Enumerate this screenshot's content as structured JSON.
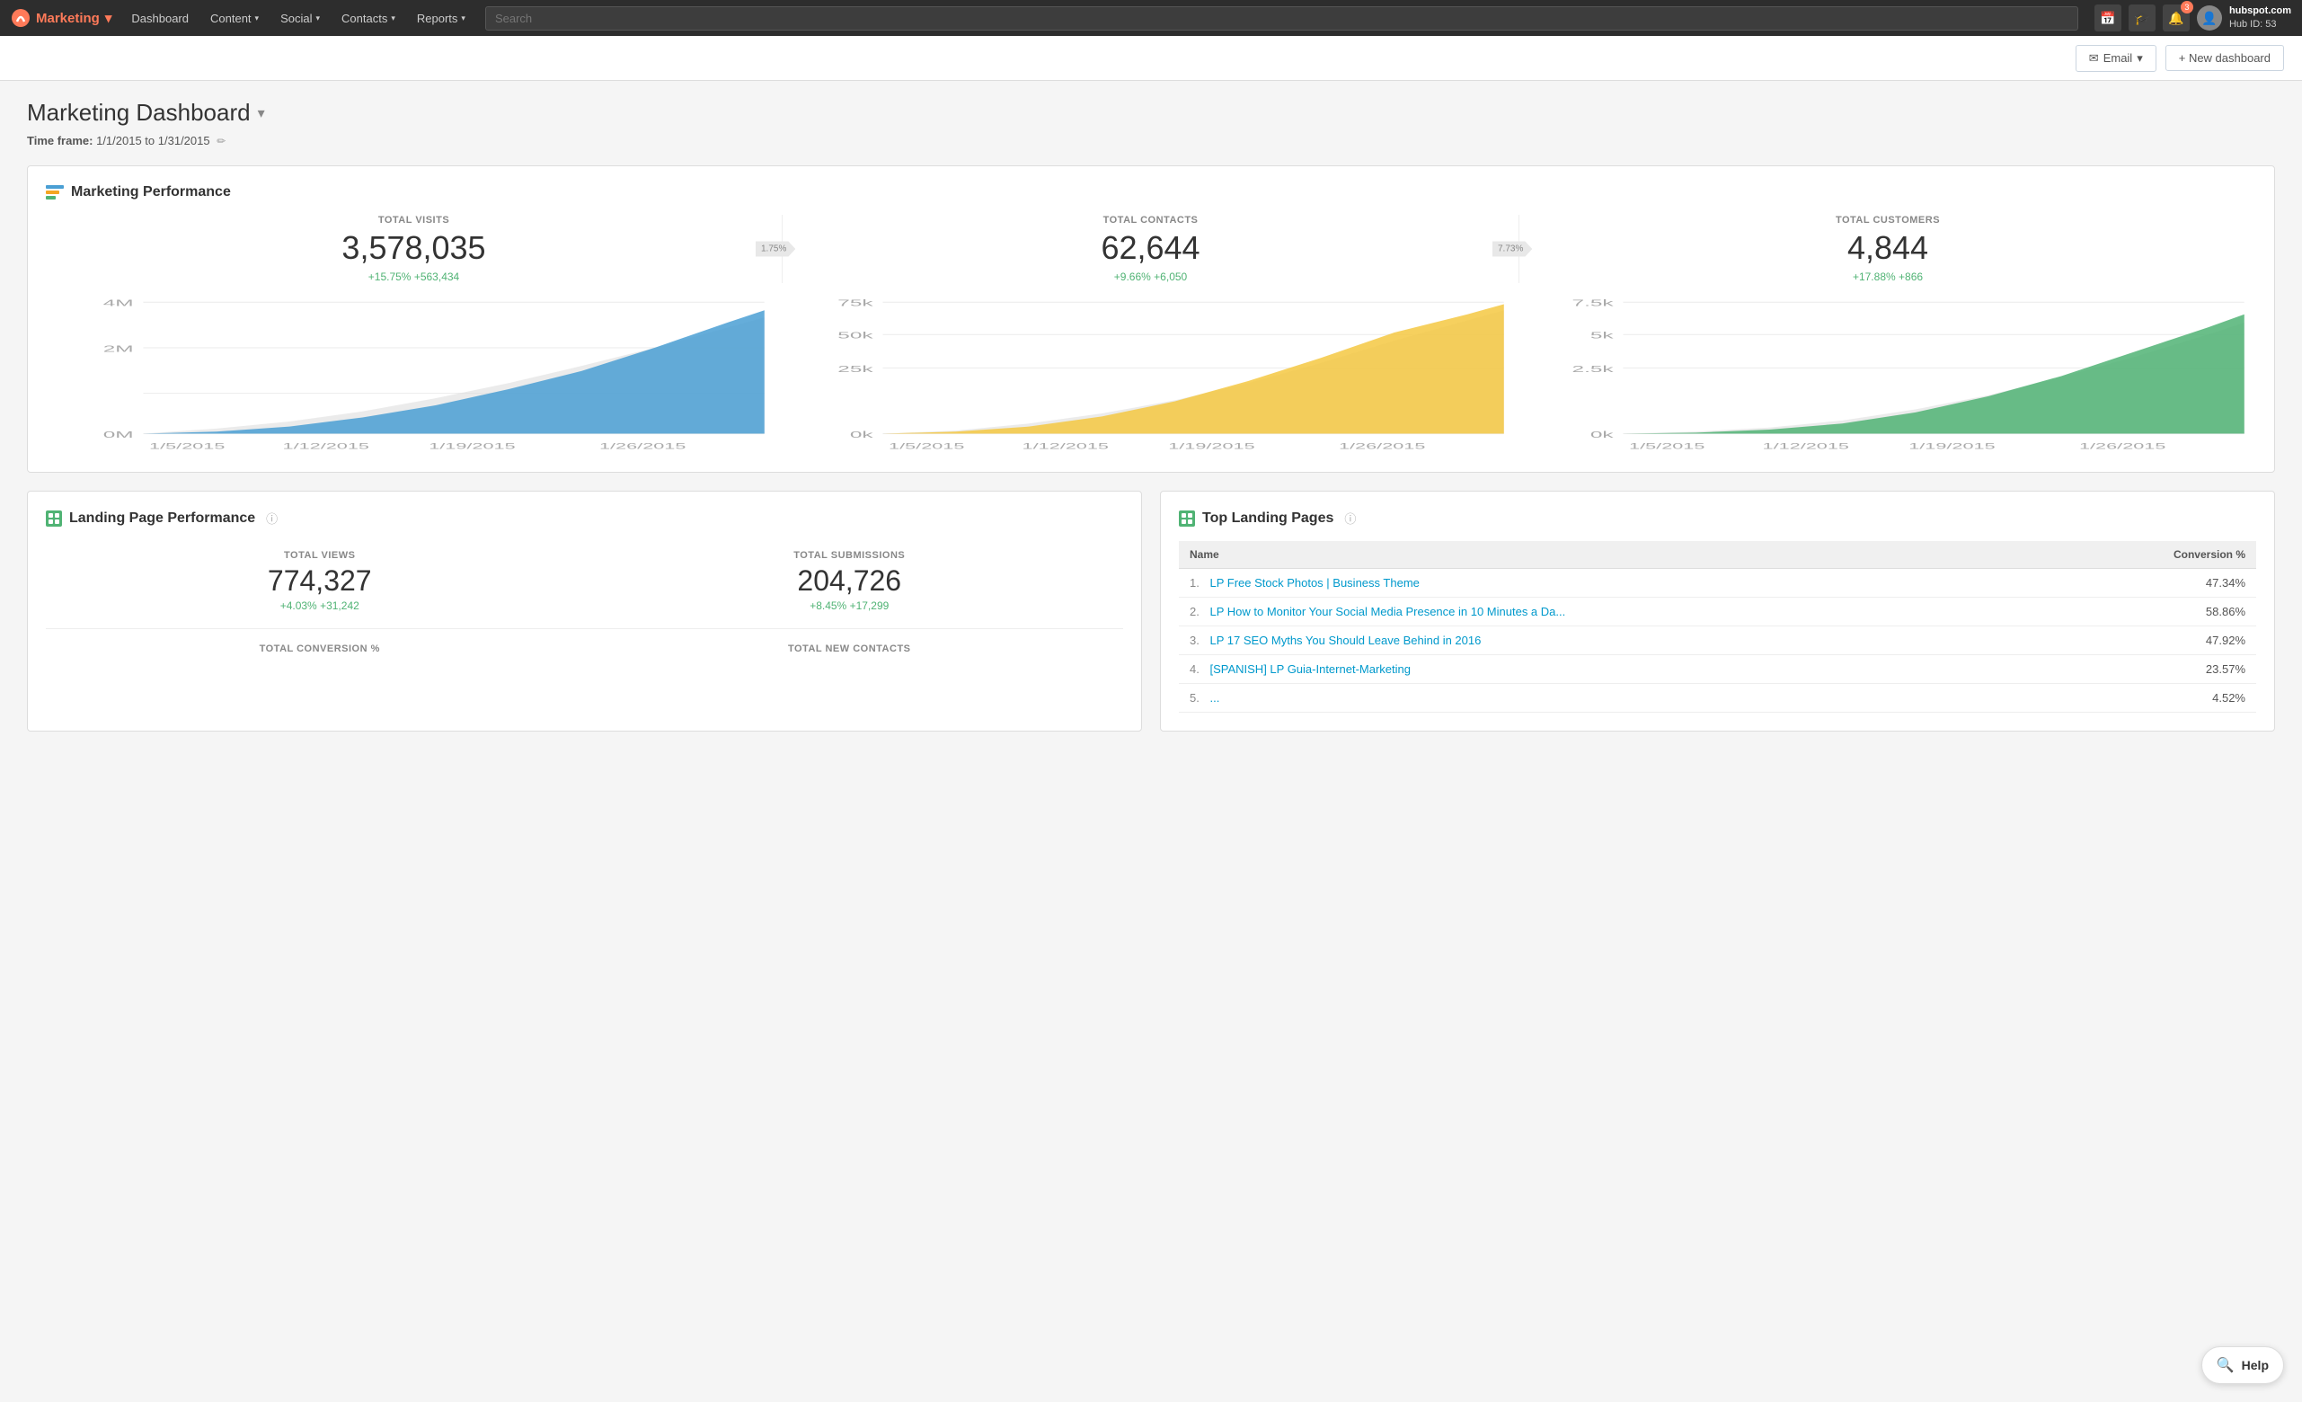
{
  "brand": {
    "name": "Marketing",
    "hub_name": "hubspot.com",
    "hub_id": "Hub ID: 53"
  },
  "nav": {
    "items": [
      {
        "label": "Marketing",
        "has_dropdown": true
      },
      {
        "label": "Dashboard",
        "has_dropdown": false
      },
      {
        "label": "Content",
        "has_dropdown": true
      },
      {
        "label": "Social",
        "has_dropdown": true
      },
      {
        "label": "Contacts",
        "has_dropdown": true
      },
      {
        "label": "Reports",
        "has_dropdown": true
      }
    ],
    "search_placeholder": "Search",
    "notification_count": "3"
  },
  "subbar": {
    "email_label": "Email",
    "new_dashboard_label": "+ New dashboard"
  },
  "page": {
    "title": "Marketing Dashboard",
    "timeframe_label": "Time frame:",
    "timeframe_value": "1/1/2015 to 1/31/2015"
  },
  "marketing_performance": {
    "title": "Marketing Performance",
    "metrics": [
      {
        "label": "TOTAL VISITS",
        "value": "3,578,035",
        "change_pct": "+15.75%",
        "change_abs": "+563,434",
        "conversion_badge": null
      },
      {
        "label": "TOTAL CONTACTS",
        "value": "62,644",
        "change_pct": "+9.66%",
        "change_abs": "+6,050",
        "conversion_badge": "1.75%"
      },
      {
        "label": "TOTAL CUSTOMERS",
        "value": "4,844",
        "change_pct": "+17.88%",
        "change_abs": "+866",
        "conversion_badge": "7.73%"
      }
    ],
    "charts": [
      {
        "color": "#4a9fd4",
        "y_labels": [
          "4M",
          "2M",
          "0M"
        ],
        "x_labels": [
          "1/5/2015",
          "1/12/2015",
          "1/19/2015",
          "1/26/2015"
        ]
      },
      {
        "color": "#f5c842",
        "y_labels": [
          "75k",
          "50k",
          "25k",
          "0k"
        ],
        "x_labels": [
          "1/5/2015",
          "1/12/2015",
          "1/19/2015",
          "1/26/2015"
        ]
      },
      {
        "color": "#50b374",
        "y_labels": [
          "7.5k",
          "5k",
          "2.5k",
          "0k"
        ],
        "x_labels": [
          "1/5/2015",
          "1/12/2015",
          "1/19/2015",
          "1/26/2015"
        ]
      }
    ]
  },
  "landing_page_performance": {
    "title": "Landing Page Performance",
    "metrics": [
      {
        "label": "TOTAL VIEWS",
        "value": "774,327",
        "change_pct": "+4.03%",
        "change_abs": "+31,242"
      },
      {
        "label": "TOTAL SUBMISSIONS",
        "value": "204,726",
        "change_pct": "+8.45%",
        "change_abs": "+17,299"
      }
    ],
    "bottom_labels": [
      "TOTAL CONVERSION %",
      "TOTAL NEW CONTACTS"
    ]
  },
  "top_landing_pages": {
    "title": "Top Landing Pages",
    "col_name": "Name",
    "col_conversion": "Conversion %",
    "rows": [
      {
        "num": "1.",
        "name": "LP Free Stock Photos | Business Theme",
        "conversion": "47.34%"
      },
      {
        "num": "2.",
        "name": "LP How to Monitor Your Social Media Presence in 10 Minutes a Da...",
        "conversion": "58.86%"
      },
      {
        "num": "3.",
        "name": "LP 17 SEO Myths You Should Leave Behind in 2016",
        "conversion": "47.92%"
      },
      {
        "num": "4.",
        "name": "[SPANISH] LP Guia-Internet-Marketing",
        "conversion": "23.57%"
      },
      {
        "num": "5.",
        "name": "...",
        "conversion": "4.52%"
      }
    ]
  },
  "help": {
    "label": "Help"
  }
}
